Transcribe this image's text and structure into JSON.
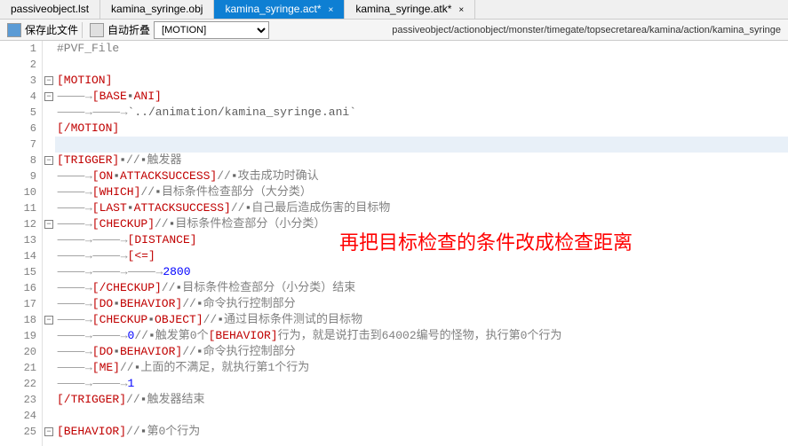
{
  "tabs": [
    {
      "label": "passiveobject.lst",
      "active": false
    },
    {
      "label": "kamina_syringe.obj",
      "active": false
    },
    {
      "label": "kamina_syringe.act*",
      "active": true
    },
    {
      "label": "kamina_syringe.atk*",
      "active": false
    }
  ],
  "toolbar": {
    "save": "保存此文件",
    "autofold": "自动折叠",
    "selector": "[MOTION]",
    "path": "passiveobject/actionobject/monster/timegate/topsecretarea/kamina/action/kamina_syringe"
  },
  "overlay_text": "再把目标检查的条件改成检查距离",
  "lines": {
    "l1": "#PVF_File",
    "l3_tag": "[MOTION]",
    "l4_tag": "[BASE",
    "l4_tag2": "ANI]",
    "l5_path": "`../animation/kamina_syringe.ani`",
    "l6_tag": "[/MOTION]",
    "l8_tag": "[TRIGGER]",
    "l8_c": "//",
    "l8_cmt": "触发器",
    "l9_tag": "[ON",
    "l9_tag2": "ATTACKSUCCESS]",
    "l9_c": "//",
    "l9_cmt": "攻击成功时确认",
    "l10_tag": "[WHICH]",
    "l10_c": "//",
    "l10_cmt": "目标条件检查部分（大分类）",
    "l11_tag": "[LAST",
    "l11_tag2": "ATTACKSUCCESS]",
    "l11_c": "//",
    "l11_cmt": "自己最后造成伤害的目标物",
    "l12_tag": "[CHECKUP]",
    "l12_c": "//",
    "l12_cmt": "目标条件检查部分（小分类）",
    "l13_tag": "[DISTANCE]",
    "l14_tag": "[<=]",
    "l15_num": "2800",
    "l16_tag": "[/CHECKUP]",
    "l16_c": "//",
    "l16_cmt": "目标条件检查部分（小分类）结束",
    "l17_tag": "[DO",
    "l17_tag2": "BEHAVIOR]",
    "l17_c": "//",
    "l17_cmt": "命令执行控制部分",
    "l18_tag": "[CHECKUP",
    "l18_tag2": "OBJECT]",
    "l18_c": "//",
    "l18_cmt": "通过目标条件测试的目标物",
    "l19_num": "0",
    "l19_c": "//",
    "l19_p1": "触发第0个",
    "l19_beh": "[BEHAVIOR]",
    "l19_p2": "行为，就是说打击到64002编号的怪物，执行第0个行为",
    "l20_tag": "[DO",
    "l20_tag2": "BEHAVIOR]",
    "l20_c": "//",
    "l20_cmt": "命令执行控制部分",
    "l21_tag": "[ME]",
    "l21_c": "//",
    "l21_cmt": "上面的不满足，就执行第1个行为",
    "l22_num": "1",
    "l23_tag": "[/TRIGGER]",
    "l23_c": "//",
    "l23_cmt": "触发器结束",
    "l25_tag": "[BEHAVIOR]",
    "l25_c": "//",
    "l25_cmt": "第0个行为"
  }
}
